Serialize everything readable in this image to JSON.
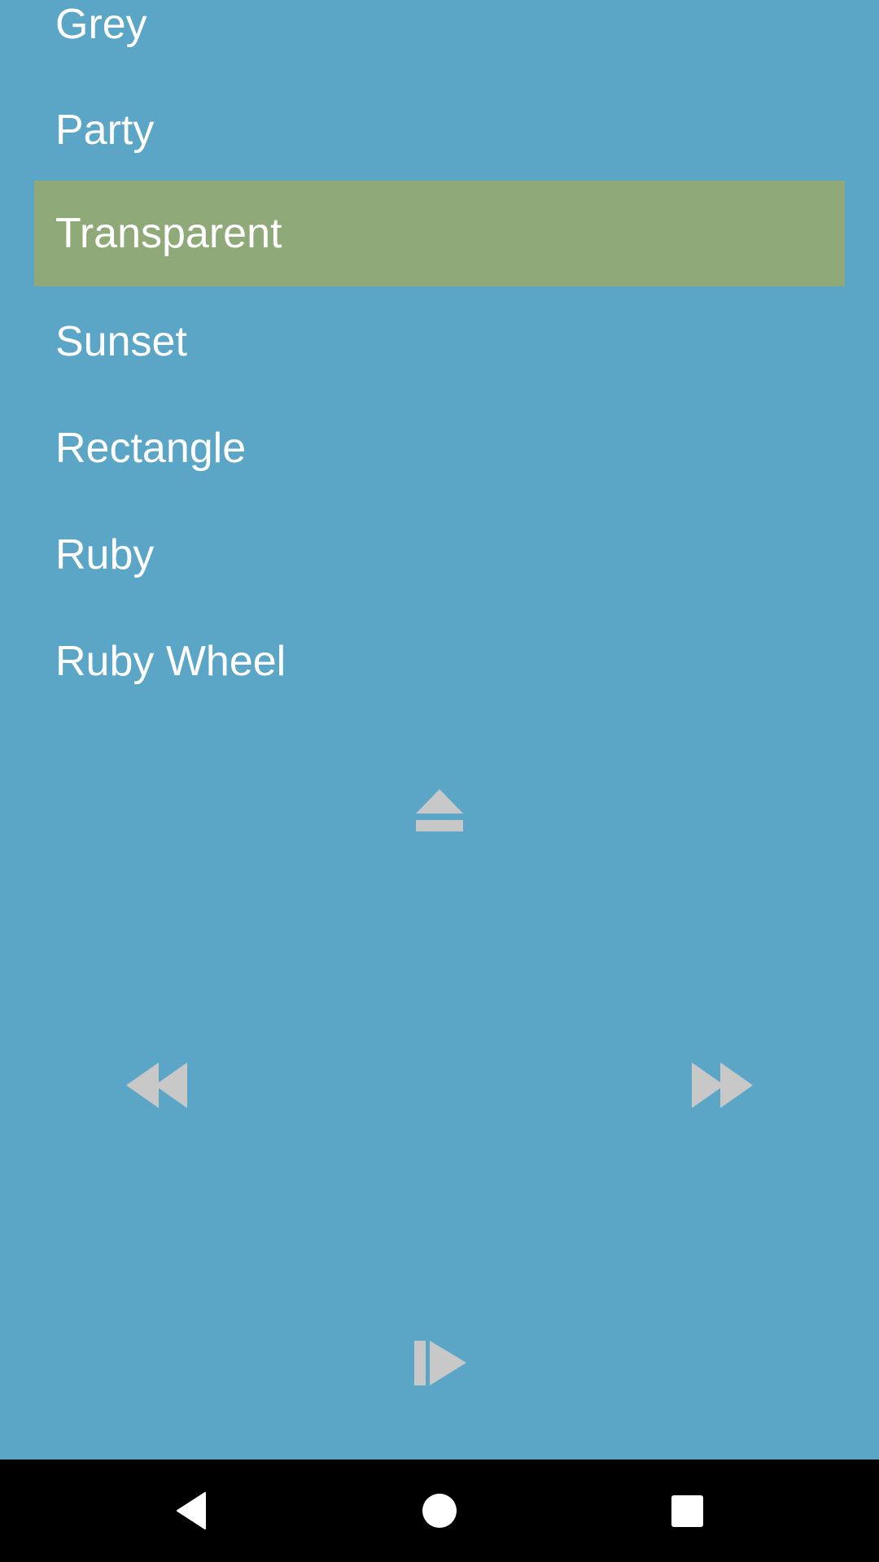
{
  "list": {
    "items": [
      {
        "label": "Grey",
        "selected": false
      },
      {
        "label": "Party",
        "selected": false
      },
      {
        "label": "Transparent",
        "selected": true
      },
      {
        "label": "Sunset",
        "selected": false
      },
      {
        "label": "Rectangle",
        "selected": false
      },
      {
        "label": "Ruby",
        "selected": false
      },
      {
        "label": "Ruby Wheel",
        "selected": false
      }
    ]
  },
  "controls": {
    "eject": "eject-icon",
    "rewind": "rewind-icon",
    "fast_forward": "fast-forward-icon",
    "play_pause": "play-pause-icon"
  },
  "navbar": {
    "back": "back-icon",
    "home": "home-icon",
    "recents": "recents-icon"
  },
  "colors": {
    "background": "#5ba5c6",
    "selected_row": "#8fa978",
    "control_icons": "#c8c8c8",
    "navbar": "#000000"
  }
}
